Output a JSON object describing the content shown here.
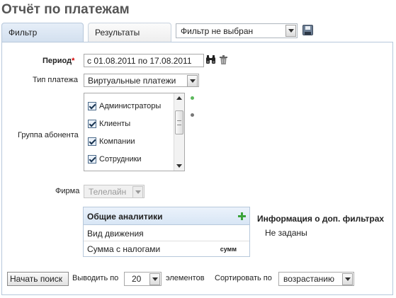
{
  "page": {
    "title": "Отчёт по платежам"
  },
  "tabs": {
    "filter": "Фильтр",
    "results": "Результаты"
  },
  "filter_preset": {
    "value": "Фильтр не выбран"
  },
  "period": {
    "label": "Период",
    "required_mark": "*",
    "value": "с 01.08.2011 по 17.08.2011"
  },
  "payment_type": {
    "label": "Тип платежа",
    "value": "Виртуальные платежи"
  },
  "subscriber_group": {
    "label": "Группа абонента",
    "items": [
      {
        "label": "Администраторы",
        "checked": true
      },
      {
        "label": "Клиенты",
        "checked": true
      },
      {
        "label": "Компании",
        "checked": true
      },
      {
        "label": "Сотрудники",
        "checked": true
      }
    ]
  },
  "firm": {
    "label": "Фирма",
    "value": "Телелайн",
    "disabled": true
  },
  "analytics": {
    "header": "Общие аналитики",
    "rows": [
      {
        "label": "Вид движения",
        "tag": ""
      },
      {
        "label": "Сумма с налогами",
        "tag": "сумм"
      }
    ]
  },
  "extra_filters": {
    "title": "Информация о доп. фильтрах",
    "value": "Не заданы"
  },
  "bottom": {
    "search_button": "Начать поиск",
    "show_by_label": "Выводить по",
    "count_value": "20",
    "elements_label": "элементов",
    "sort_label": "Сортировать по",
    "sort_value": "возрастанию"
  },
  "colors": {
    "accent_tab": "#d3e0ef",
    "border": "#b7c8db",
    "required": "#d00000",
    "plus": "#3aa23a"
  }
}
